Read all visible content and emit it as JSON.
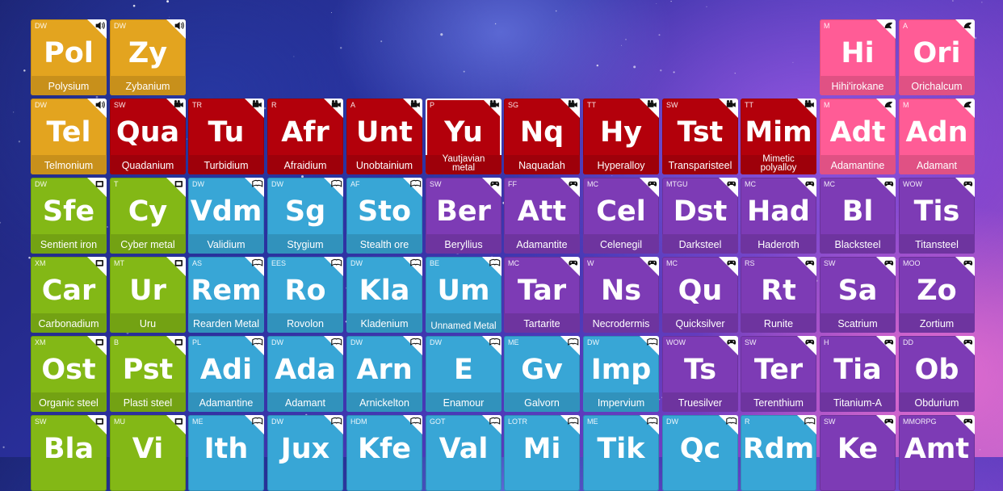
{
  "colors": {
    "durable": "#e3a41f",
    "rare": "#b3000b",
    "mineral": "#ff5c96",
    "fictional_metal": "#83b816",
    "alloy": "#38a6d6",
    "game": "#7d3bb5"
  },
  "rows": [
    [
      {
        "col": 0,
        "cat": "DW",
        "sym": "Pol",
        "name": "Polysium",
        "color": "durable",
        "icon": "speaker-icon"
      },
      {
        "col": 1,
        "cat": "DW",
        "sym": "Zy",
        "name": "Zybanium",
        "color": "durable",
        "icon": "speaker-icon"
      },
      {
        "col": 10,
        "cat": "M",
        "sym": "Hi",
        "name": "Hihi'irokane",
        "color": "mineral",
        "icon": "mask-icon"
      },
      {
        "col": 11,
        "cat": "A",
        "sym": "Ori",
        "name": "Orichalcum",
        "color": "mineral",
        "icon": "mask-icon"
      }
    ],
    [
      {
        "col": 0,
        "cat": "DW",
        "sym": "Tel",
        "name": "Telmonium",
        "color": "durable",
        "icon": "speaker-icon"
      },
      {
        "col": 1,
        "cat": "SW",
        "sym": "Qua",
        "name": "Quadanium",
        "color": "rare",
        "icon": "film-icon"
      },
      {
        "col": 2,
        "cat": "TR",
        "sym": "Tu",
        "name": "Turbidium",
        "color": "rare",
        "icon": "film-icon"
      },
      {
        "col": 3,
        "cat": "R",
        "sym": "Afr",
        "name": "Afraidium",
        "color": "rare",
        "icon": "film-icon"
      },
      {
        "col": 4,
        "cat": "A",
        "sym": "Unt",
        "name": "Unobtainium",
        "color": "rare",
        "icon": "film-icon"
      },
      {
        "col": 5,
        "cat": "P",
        "sym": "Yu",
        "name": "Yautjavian metal",
        "color": "rare",
        "icon": "film-icon",
        "selected": true,
        "two": true
      },
      {
        "col": 6,
        "cat": "SG",
        "sym": "Nq",
        "name": "Naquadah",
        "color": "rare",
        "icon": "film-icon"
      },
      {
        "col": 7,
        "cat": "TT",
        "sym": "Hy",
        "name": "Hyperalloy",
        "color": "rare",
        "icon": "film-icon"
      },
      {
        "col": 8,
        "cat": "SW",
        "sym": "Tst",
        "name": "Transparisteel",
        "color": "rare",
        "icon": "film-icon"
      },
      {
        "col": 9,
        "cat": "TT",
        "sym": "Mim",
        "name": "Mimetic polyalloy",
        "color": "rare",
        "icon": "film-icon",
        "two": true
      },
      {
        "col": 10,
        "cat": "M",
        "sym": "Adt",
        "name": "Adamantine",
        "color": "mineral",
        "icon": "mask-icon"
      },
      {
        "col": 11,
        "cat": "M",
        "sym": "Adn",
        "name": "Adamant",
        "color": "mineral",
        "icon": "mask-icon"
      }
    ],
    [
      {
        "col": 0,
        "cat": "DW",
        "sym": "Sfe",
        "name": "Sentient iron",
        "color": "fictional_metal",
        "icon": "tv-icon"
      },
      {
        "col": 1,
        "cat": "T",
        "sym": "Cy",
        "name": "Cyber metal",
        "color": "fictional_metal",
        "icon": "tv-icon"
      },
      {
        "col": 2,
        "cat": "DW",
        "sym": "Vdm",
        "name": "Validium",
        "color": "alloy",
        "icon": "book-icon"
      },
      {
        "col": 3,
        "cat": "DW",
        "sym": "Sg",
        "name": "Stygium",
        "color": "alloy",
        "icon": "book-icon"
      },
      {
        "col": 4,
        "cat": "AF",
        "sym": "Sto",
        "name": "Stealth ore",
        "color": "alloy",
        "icon": "book-icon"
      },
      {
        "col": 5,
        "cat": "SW",
        "sym": "Ber",
        "name": "Beryllius",
        "color": "game",
        "icon": "gamepad-icon"
      },
      {
        "col": 6,
        "cat": "FF",
        "sym": "Att",
        "name": "Adamantite",
        "color": "game",
        "icon": "gamepad-icon"
      },
      {
        "col": 7,
        "cat": "MC",
        "sym": "Cel",
        "name": "Celenegil",
        "color": "game",
        "icon": "gamepad-icon"
      },
      {
        "col": 8,
        "cat": "MTGU",
        "sym": "Dst",
        "name": "Darksteel",
        "color": "game",
        "icon": "gamepad-icon"
      },
      {
        "col": 9,
        "cat": "MC",
        "sym": "Had",
        "name": "Haderoth",
        "color": "game",
        "icon": "gamepad-icon"
      },
      {
        "col": 10,
        "cat": "MC",
        "sym": "Bl",
        "name": "Blacksteel",
        "color": "game",
        "icon": "gamepad-icon"
      },
      {
        "col": 11,
        "cat": "WOW",
        "sym": "Tis",
        "name": "Titansteel",
        "color": "game",
        "icon": "gamepad-icon"
      }
    ],
    [
      {
        "col": 0,
        "cat": "XM",
        "sym": "Car",
        "name": "Carbonadium",
        "color": "fictional_metal",
        "icon": "tv-icon"
      },
      {
        "col": 1,
        "cat": "MT",
        "sym": "Ur",
        "name": "Uru",
        "color": "fictional_metal",
        "icon": "tv-icon"
      },
      {
        "col": 2,
        "cat": "AS",
        "sym": "Rem",
        "name": "Rearden Metal",
        "color": "alloy",
        "icon": "book-icon"
      },
      {
        "col": 3,
        "cat": "EES",
        "sym": "Ro",
        "name": "Rovolon",
        "color": "alloy",
        "icon": "book-icon"
      },
      {
        "col": 4,
        "cat": "DW",
        "sym": "Kla",
        "name": "Kladenium",
        "color": "alloy",
        "icon": "book-icon"
      },
      {
        "col": 5,
        "cat": "BE",
        "sym": "Um",
        "name": "Unnamed Metal",
        "color": "alloy",
        "icon": "book-icon",
        "two": true
      },
      {
        "col": 6,
        "cat": "MC",
        "sym": "Tar",
        "name": "Tartarite",
        "color": "game",
        "icon": "gamepad-icon"
      },
      {
        "col": 7,
        "cat": "W",
        "sym": "Ns",
        "name": "Necrodermis",
        "color": "game",
        "icon": "gamepad-icon"
      },
      {
        "col": 8,
        "cat": "MC",
        "sym": "Qu",
        "name": "Quicksilver",
        "color": "game",
        "icon": "gamepad-icon"
      },
      {
        "col": 9,
        "cat": "RS",
        "sym": "Rt",
        "name": "Runite",
        "color": "game",
        "icon": "gamepad-icon"
      },
      {
        "col": 10,
        "cat": "SW",
        "sym": "Sa",
        "name": "Scatrium",
        "color": "game",
        "icon": "gamepad-icon"
      },
      {
        "col": 11,
        "cat": "MOO",
        "sym": "Zo",
        "name": "Zortium",
        "color": "game",
        "icon": "gamepad-icon"
      }
    ],
    [
      {
        "col": 0,
        "cat": "XM",
        "sym": "Ost",
        "name": "Organic steel",
        "color": "fictional_metal",
        "icon": "tv-icon"
      },
      {
        "col": 1,
        "cat": "B",
        "sym": "Pst",
        "name": "Plasti steel",
        "color": "fictional_metal",
        "icon": "tv-icon"
      },
      {
        "col": 2,
        "cat": "PL",
        "sym": "Adi",
        "name": "Adamantine",
        "color": "alloy",
        "icon": "book-icon"
      },
      {
        "col": 3,
        "cat": "DW",
        "sym": "Ada",
        "name": "Adamant",
        "color": "alloy",
        "icon": "book-icon"
      },
      {
        "col": 4,
        "cat": "DW",
        "sym": "Arn",
        "name": "Arnickelton",
        "color": "alloy",
        "icon": "book-icon"
      },
      {
        "col": 5,
        "cat": "DW",
        "sym": "E",
        "name": "Enamour",
        "color": "alloy",
        "icon": "book-icon"
      },
      {
        "col": 6,
        "cat": "ME",
        "sym": "Gv",
        "name": "Galvorn",
        "color": "alloy",
        "icon": "book-icon"
      },
      {
        "col": 7,
        "cat": "DW",
        "sym": "Imp",
        "name": "Impervium",
        "color": "alloy",
        "icon": "book-icon"
      },
      {
        "col": 8,
        "cat": "WOW",
        "sym": "Ts",
        "name": "Truesilver",
        "color": "game",
        "icon": "gamepad-icon"
      },
      {
        "col": 9,
        "cat": "SW",
        "sym": "Ter",
        "name": "Terenthium",
        "color": "game",
        "icon": "gamepad-icon"
      },
      {
        "col": 10,
        "cat": "H",
        "sym": "Tia",
        "name": "Titanium-A",
        "color": "game",
        "icon": "gamepad-icon"
      },
      {
        "col": 11,
        "cat": "DD",
        "sym": "Ob",
        "name": "Obdurium",
        "color": "game",
        "icon": "gamepad-icon"
      }
    ],
    [
      {
        "col": 0,
        "cat": "SW",
        "sym": "Bla",
        "name": "",
        "color": "fictional_metal",
        "icon": "tv-icon"
      },
      {
        "col": 1,
        "cat": "MU",
        "sym": "Vi",
        "name": "",
        "color": "fictional_metal",
        "icon": "tv-icon"
      },
      {
        "col": 2,
        "cat": "ME",
        "sym": "Ith",
        "name": "",
        "color": "alloy",
        "icon": "book-icon"
      },
      {
        "col": 3,
        "cat": "DW",
        "sym": "Jux",
        "name": "",
        "color": "alloy",
        "icon": "book-icon"
      },
      {
        "col": 4,
        "cat": "HDM",
        "sym": "Kfe",
        "name": "",
        "color": "alloy",
        "icon": "book-icon"
      },
      {
        "col": 5,
        "cat": "GOT",
        "sym": "Val",
        "name": "",
        "color": "alloy",
        "icon": "book-icon"
      },
      {
        "col": 6,
        "cat": "LOTR",
        "sym": "Mi",
        "name": "",
        "color": "alloy",
        "icon": "book-icon"
      },
      {
        "col": 7,
        "cat": "ME",
        "sym": "Tik",
        "name": "",
        "color": "alloy",
        "icon": "book-icon"
      },
      {
        "col": 8,
        "cat": "DW",
        "sym": "Qc",
        "name": "",
        "color": "alloy",
        "icon": "book-icon"
      },
      {
        "col": 9,
        "cat": "R",
        "sym": "Rdm",
        "name": "",
        "color": "alloy",
        "icon": "book-icon"
      },
      {
        "col": 10,
        "cat": "SW",
        "sym": "Ke",
        "name": "",
        "color": "game",
        "icon": "gamepad-icon"
      },
      {
        "col": 11,
        "cat": "MMORPG",
        "sym": "Amt",
        "name": "",
        "color": "game",
        "icon": "gamepad-icon"
      }
    ]
  ]
}
